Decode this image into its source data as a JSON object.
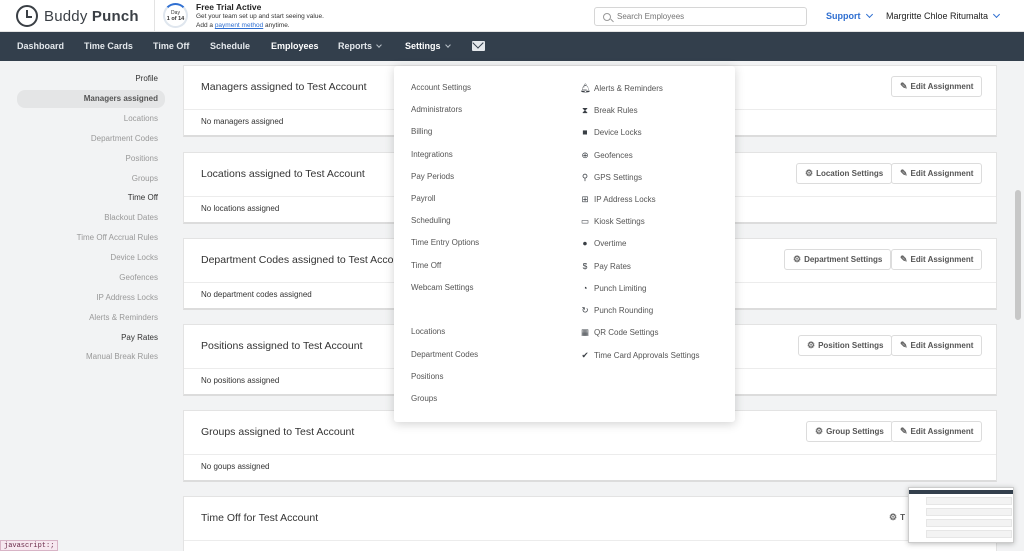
{
  "header": {
    "brand_light": "Buddy",
    "brand_bold": "Punch",
    "trial": {
      "ring_top": "Day",
      "ring_bottom": "1 of 14",
      "title": "Free Trial Active",
      "line1": "Get your team set up and start seeing value.",
      "line2_pre": "Add a",
      "line2_link": "payment method",
      "line2_post": "anytime."
    },
    "search_placeholder": "Search Employees",
    "support_label": "Support",
    "user_name": "Margritte Chloe Ritumalta"
  },
  "nav": {
    "dashboard": "Dashboard",
    "time_cards": "Time Cards",
    "time_off": "Time Off",
    "schedule": "Schedule",
    "employees": "Employees",
    "reports": "Reports",
    "settings": "Settings"
  },
  "sidebar": {
    "items": [
      {
        "label": "Profile"
      },
      {
        "label": "Managers assigned"
      },
      {
        "label": "Locations"
      },
      {
        "label": "Department Codes"
      },
      {
        "label": "Positions"
      },
      {
        "label": "Groups"
      },
      {
        "label": "Time Off"
      },
      {
        "label": "Blackout Dates"
      },
      {
        "label": "Time Off Accrual Rules"
      },
      {
        "label": "Device Locks"
      },
      {
        "label": "Geofences"
      },
      {
        "label": "IP Address Locks"
      },
      {
        "label": "Alerts & Reminders"
      },
      {
        "label": "Pay Rates"
      },
      {
        "label": "Manual Break Rules"
      }
    ]
  },
  "cards": {
    "managers": {
      "title": "Managers assigned to Test Account",
      "empty": "No managers assigned",
      "edit": "Edit Assignment"
    },
    "locations": {
      "title": "Locations assigned to Test Account",
      "empty": "No locations assigned",
      "settings": "Location Settings",
      "edit": "Edit Assignment"
    },
    "departments": {
      "title": "Department Codes assigned to Test Account",
      "empty": "No department codes assigned",
      "settings": "Department Settings",
      "edit": "Edit Assignment"
    },
    "positions": {
      "title": "Positions assigned to Test Account",
      "empty": "No positions assigned",
      "settings": "Position Settings",
      "edit": "Edit Assignment"
    },
    "groups": {
      "title": "Groups assigned to Test Account",
      "empty": "No goups assigned",
      "settings": "Group Settings",
      "edit": "Edit Assignment"
    },
    "timeoff": {
      "title": "Time Off for Test Account",
      "settings_partial": "T"
    }
  },
  "settings_menu": {
    "left": [
      "Account Settings",
      "Administrators",
      "Billing",
      "Integrations",
      "Pay Periods",
      "Payroll",
      "Scheduling",
      "Time Entry Options",
      "Time Off",
      "Webcam Settings",
      "Locations",
      "Department Codes",
      "Positions",
      "Groups"
    ],
    "right": [
      {
        "label": "Alerts & Reminders",
        "icon": "bell-icon"
      },
      {
        "label": "Break Rules",
        "icon": "hourglass-icon"
      },
      {
        "label": "Device Locks",
        "icon": "lock-icon"
      },
      {
        "label": "Geofences",
        "icon": "globe-icon"
      },
      {
        "label": "GPS Settings",
        "icon": "map-pin-icon"
      },
      {
        "label": "IP Address Locks",
        "icon": "network-icon"
      },
      {
        "label": "Kiosk Settings",
        "icon": "tablet-icon"
      },
      {
        "label": "Overtime",
        "icon": "users-icon"
      },
      {
        "label": "Pay Rates",
        "icon": "dollar-icon"
      },
      {
        "label": "Punch Limiting",
        "icon": "stopwatch-icon"
      },
      {
        "label": "Punch Rounding",
        "icon": "redo-icon"
      },
      {
        "label": "QR Code Settings",
        "icon": "qrcode-icon"
      },
      {
        "label": "Time Card Approvals Settings",
        "icon": "check-circle-icon"
      }
    ]
  },
  "status_bar": "javascript:;",
  "colors": {
    "nav_bg": "#333f4c",
    "accent": "#2f6fd1",
    "page_bg": "#f2f3f4"
  }
}
